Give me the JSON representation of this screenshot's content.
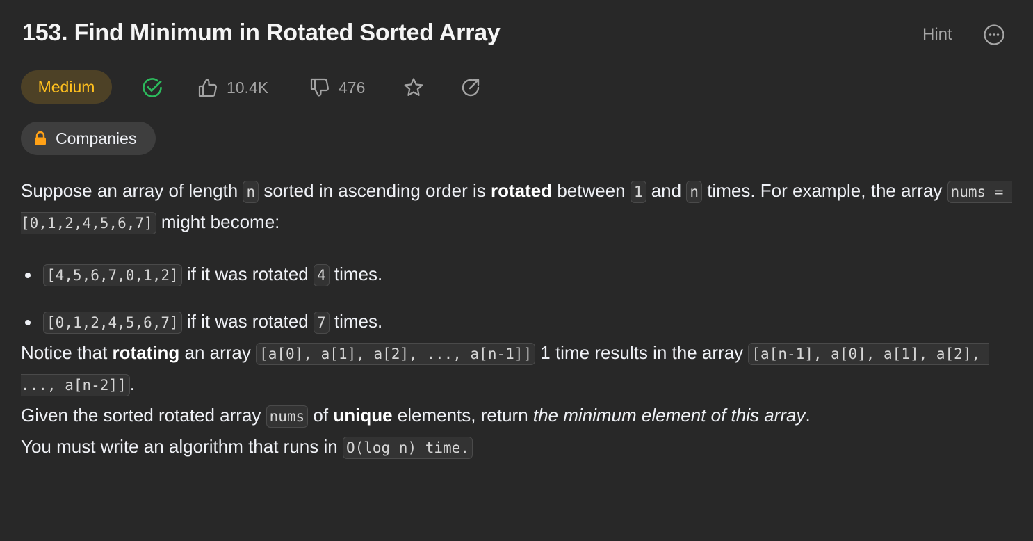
{
  "title": "153. Find Minimum in Rotated Sorted Array",
  "hint_label": "Hint",
  "difficulty": "Medium",
  "likes": "10.4K",
  "dislikes": "476",
  "companies_label": "Companies",
  "colors": {
    "difficulty_text": "#ffc01e",
    "difficulty_bg": "#4d4126",
    "solved_check": "#2cbb5d",
    "lock": "#ffa116"
  },
  "icons": {
    "more": "more-horizontal-icon",
    "solved": "check-circle-icon",
    "like": "thumbs-up-icon",
    "dislike": "thumbs-down-icon",
    "favorite": "star-icon",
    "share": "share-icon",
    "lock": "lock-icon"
  },
  "description": {
    "p1": {
      "t1": "Suppose an array of length ",
      "c1": "n",
      "t2": " sorted in ascending order is ",
      "b1": "rotated",
      "t3": " between ",
      "c2": "1",
      "t4": " and ",
      "c3": "n",
      "t5": " times. For example, the array ",
      "c4": "nums = [0,1,2,4,5,6,7]",
      "t6": " might become:"
    },
    "bullets": [
      {
        "code": "[4,5,6,7,0,1,2]",
        "t1": " if it was rotated ",
        "n": "4",
        "t2": " times."
      },
      {
        "code": "[0,1,2,4,5,6,7]",
        "t1": " if it was rotated ",
        "n": "7",
        "t2": " times."
      }
    ],
    "p2": {
      "t1": "Notice that ",
      "b1": "rotating",
      "t2": " an array ",
      "c1": "[a[0], a[1], a[2], ..., a[n-1]]",
      "t3": " 1 time results in the array ",
      "c2": "[a[n-1], a[0], a[1], a[2], ..., a[n-2]]",
      "t4": "."
    },
    "p3": {
      "t1": "Given the sorted rotated array ",
      "c1": "nums",
      "t2": " of ",
      "b1": "unique",
      "t3": " elements, return ",
      "i1": "the minimum element of this array",
      "t4": "."
    },
    "p4": {
      "t1": "You must write an algorithm that runs in ",
      "c1": "O(log n) time."
    }
  }
}
